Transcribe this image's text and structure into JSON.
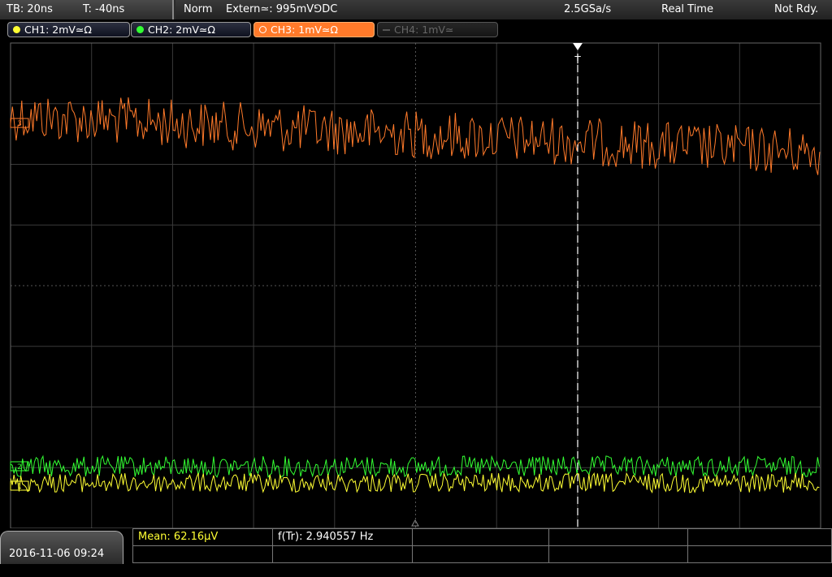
{
  "timebase": {
    "tb": "TB: 20ns",
    "t": "T: -40ns"
  },
  "status": {
    "mode": "Norm",
    "trigger": "Extern≃: 995mV⅁DC",
    "sample_rate": "2.5GSa/s",
    "acq": "Real Time",
    "ready": "Not Rdy."
  },
  "channels": [
    {
      "label": "CH1: 2mV≃Ω",
      "color": "#ffff33",
      "state": "on"
    },
    {
      "label": "CH2: 2mV≃Ω",
      "color": "#33ff33",
      "state": "on"
    },
    {
      "label": "CH3: 1mV≃Ω",
      "color": "#ff7a2a",
      "state": "active"
    },
    {
      "label": "CH4: 1mV≃",
      "color": "#555555",
      "state": "off"
    }
  ],
  "markers": {
    "ch1": "1",
    "ch2": "2",
    "ch3": "3",
    "trigger": "T"
  },
  "datetime": "2016-11-06 09:24",
  "measurements": {
    "mean": "Mean: 62.16µV",
    "freq": "f(Tr): 2.940557 Hz"
  },
  "colors": {
    "ch1": "#ffff33",
    "ch2": "#33ff33",
    "ch3": "#ff7a2a",
    "grid": "#404040",
    "background": "#000000",
    "mean_text": "#ffff33"
  }
}
